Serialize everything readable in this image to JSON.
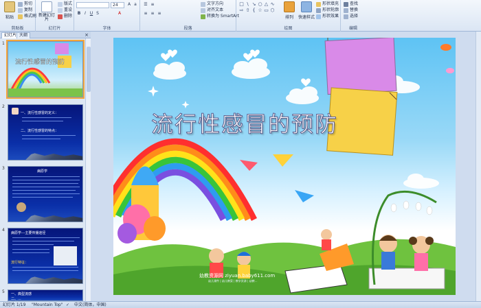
{
  "ribbon": {
    "clipboard": {
      "label": "剪贴板",
      "paste": "粘贴",
      "cut": "剪切",
      "copy": "复制",
      "format_painter": "格式刷"
    },
    "slides": {
      "label": "幻灯片",
      "new_slide": "新建幻灯片",
      "layout": "版式",
      "reset": "重设",
      "delete": "删除"
    },
    "font": {
      "label": "字体",
      "font_size": "24"
    },
    "paragraph": {
      "label": "段落",
      "text_direction": "文字方向",
      "align_text": "对齐文本",
      "smartart": "转换为 SmartArt"
    },
    "drawing": {
      "label": "绘图",
      "arrange": "排列",
      "quick_styles": "快速样式",
      "shape_fill": "形状填充",
      "shape_outline": "形状轮廓",
      "shape_effects": "形状效果"
    },
    "editing": {
      "label": "编辑",
      "find": "查找",
      "replace": "替换",
      "select": "选择"
    }
  },
  "left_panel": {
    "tab_slides": "幻灯片",
    "tab_outline": "大纲",
    "close": "×",
    "thumbs": [
      {
        "number": "1",
        "title": "流行性感冒的预防"
      },
      {
        "number": "2",
        "lines": [
          "一、流行性感冒的定义：",
          "二、流行性感冒的特点："
        ]
      },
      {
        "number": "3",
        "title": "病原学"
      },
      {
        "number": "4",
        "title": "病原学---主要传播途径",
        "caption": "流行特征："
      },
      {
        "number": "5",
        "lines": [
          "一、典型流感",
          "二、..."
        ]
      }
    ]
  },
  "slide": {
    "title": "流行性感冒的预防",
    "watermark": "幼教资源网 ziyuan.baby611.com",
    "watermark_small": "幼儿课件 | 幼儿教案 | 教学资源 | 幼教..."
  },
  "status": {
    "slide_info": "幻灯片 1/19",
    "theme": "\"Mountain Top\"",
    "language": "中文(简体，中国)"
  },
  "colors": {
    "ribbon_bg": "#dbe6f4",
    "selection": "#f3a63b",
    "slide_title": "#ffffff",
    "dark_slide": "#0a2fa8"
  }
}
